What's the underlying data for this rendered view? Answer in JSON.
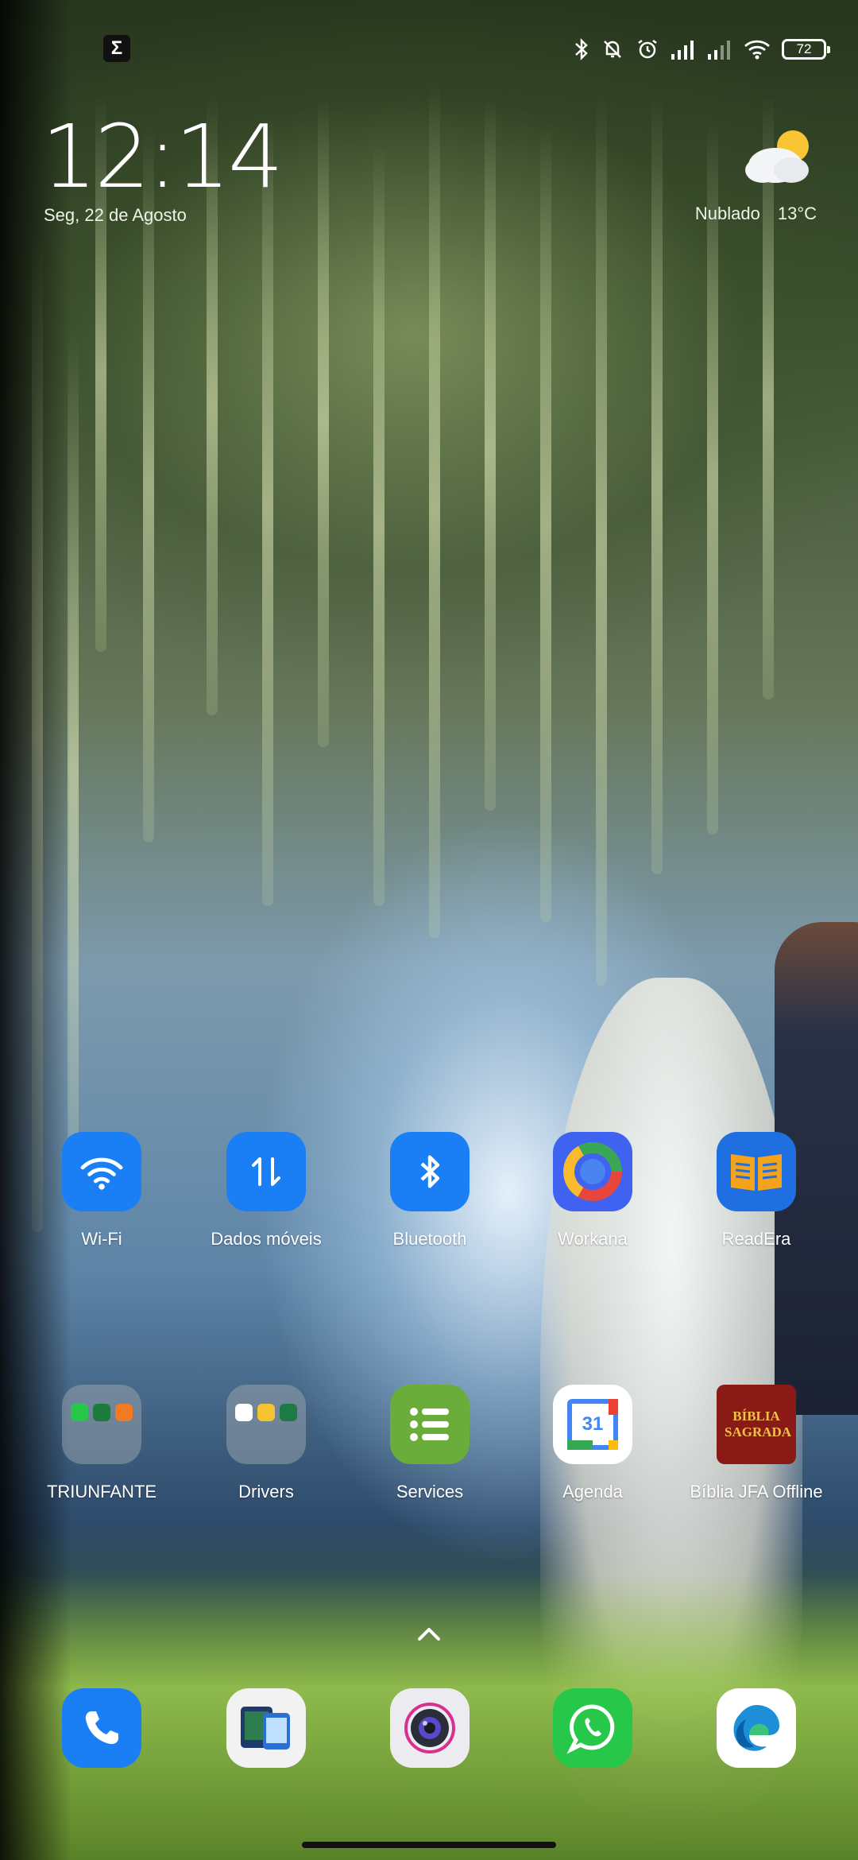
{
  "status_bar": {
    "left_icon": "sigma-notification-icon",
    "right_icons": [
      "bluetooth-icon",
      "silent-notifications-icon",
      "alarm-icon",
      "signal-icon",
      "signal-icon",
      "wifi-icon"
    ],
    "battery": "72"
  },
  "clock_widget": {
    "time": "12:14",
    "date": "Seg, 22 de Agosto"
  },
  "weather_widget": {
    "condition": "Nublado",
    "temperature": "13°C",
    "icon": "partly-cloudy-icon"
  },
  "home_row_1": [
    {
      "label": "Wi-Fi",
      "icon": "wifi-icon",
      "color": "#1a7ef5"
    },
    {
      "label": "Dados móveis",
      "icon": "mobile-data-icon",
      "color": "#1a7ef5"
    },
    {
      "label": "Bluetooth",
      "icon": "bluetooth-icon",
      "color": "#1a7ef5"
    },
    {
      "label": "Workana",
      "icon": "workana-icon",
      "color": "#3f62f0"
    },
    {
      "label": "ReadEra",
      "icon": "book-icon",
      "color": "#1f6fe0"
    }
  ],
  "home_row_2": [
    {
      "label": "TRIUNFANTE",
      "icon": "folder-icon"
    },
    {
      "label": "Drivers",
      "icon": "folder-icon"
    },
    {
      "label": "Services",
      "icon": "list-icon",
      "color": "#6bad3a"
    },
    {
      "label": "Agenda",
      "icon": "calendar-icon",
      "day": "31"
    },
    {
      "label": "Bíblia JFA Offline",
      "icon": "bible-icon",
      "cover_text": "BÍBLIA SAGRADA",
      "color": "#8a1a16"
    }
  ],
  "dock": [
    {
      "name": "phone",
      "icon": "phone-icon",
      "color": "#1a7ef5"
    },
    {
      "name": "app-switch",
      "icon": "phone-transfer-icon"
    },
    {
      "name": "camera",
      "icon": "camera-icon"
    },
    {
      "name": "whatsapp",
      "icon": "whatsapp-icon",
      "color": "#27c84a"
    },
    {
      "name": "edge",
      "icon": "edge-icon"
    }
  ]
}
